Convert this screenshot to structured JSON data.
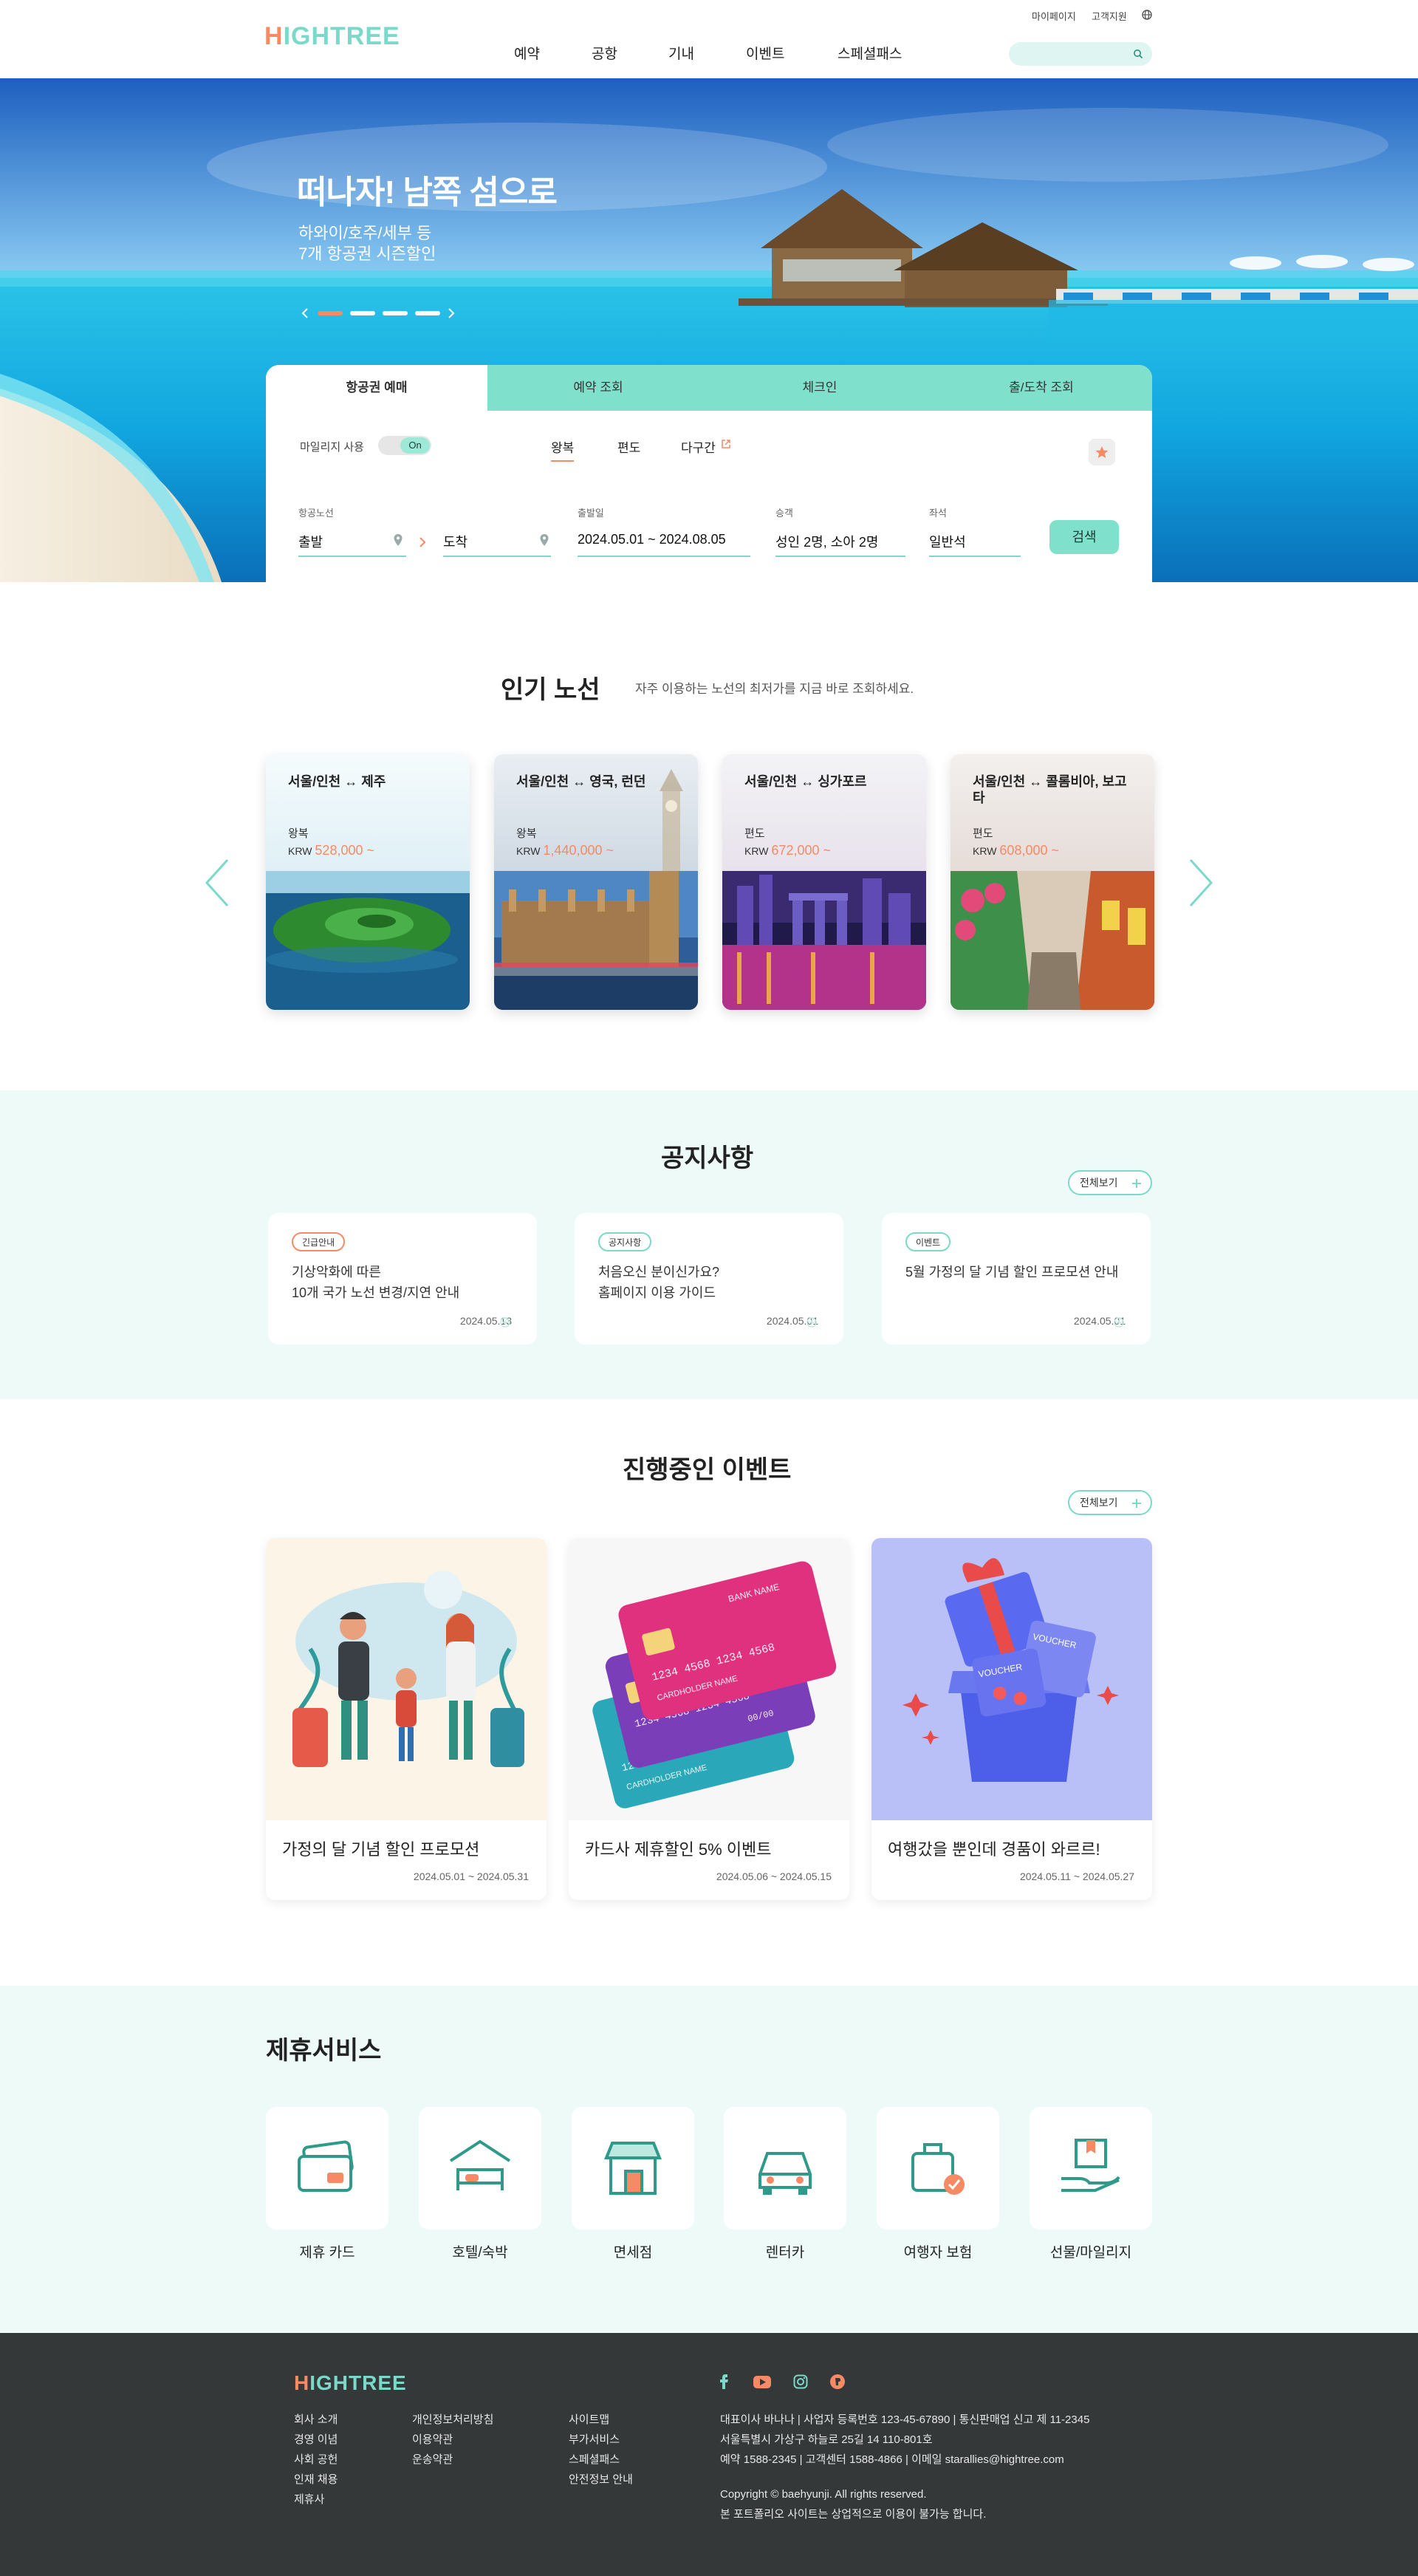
{
  "header": {
    "logo_first": "H",
    "logo_rest": "IGHTREE",
    "util_mypage": "마이페이지",
    "util_support": "고객지원",
    "nav": [
      "예약",
      "공항",
      "기내",
      "이벤트",
      "스페셜패스"
    ],
    "search_icon": "search-icon"
  },
  "hero": {
    "title": "떠나자! 남쪽 섬으로",
    "sub1": "하와이/호주/세부 등",
    "sub2": "7개 항공권 시즌할인"
  },
  "booking": {
    "tabs": [
      "항공권 예매",
      "예약 조회",
      "체크인",
      "출/도착 조회"
    ],
    "mileage_label": "마일리지 사용",
    "mileage_toggle": "On",
    "trip_types": [
      "왕복",
      "편도",
      "다구간"
    ],
    "route_label": "항공노선",
    "from": "출발",
    "to": "도착",
    "date_label": "출발일",
    "date_value": "2024.05.01 ~ 2024.08.05",
    "pax_label": "승객",
    "pax_value": "성인 2명, 소아 2명",
    "seat_label": "좌석",
    "seat_value": "일반석",
    "search_button": "검색"
  },
  "popular": {
    "title": "인기 노선",
    "subtitle": "자주 이용하는 노선의 최저가를 지금 바로 조회하세요.",
    "routes": [
      {
        "name": "서울/인천 ↔ 제주",
        "trip": "왕복",
        "currency": "KRW",
        "price": "528,000 ~"
      },
      {
        "name": "서울/인천 ↔ 영국, 런던",
        "trip": "왕복",
        "currency": "KRW",
        "price": "1,440,000 ~"
      },
      {
        "name": "서울/인천 ↔ 싱가포르",
        "trip": "편도",
        "currency": "KRW",
        "price": "672,000 ~"
      },
      {
        "name": "서울/인천 ↔ 콜롬비아, 보고타",
        "trip": "편도",
        "currency": "KRW",
        "price": "608,000 ~"
      }
    ]
  },
  "notice": {
    "title": "공지사항",
    "more": "전체보기",
    "items": [
      {
        "badge": "긴급안내",
        "line1": "기상악화에 따른",
        "line2": "10개 국가 노선 변경/지연 안내",
        "date": "2024.05.13"
      },
      {
        "badge": "공지사항",
        "line1": "처음오신 분이신가요?",
        "line2": "홈페이지 이용 가이드",
        "date": "2024.05.01"
      },
      {
        "badge": "이벤트",
        "line1": "5월 가정의 달 기념 할인 프로모션 안내",
        "line2": "",
        "date": "2024.05.01"
      }
    ]
  },
  "events": {
    "title": "진행중인 이벤트",
    "more": "전체보기",
    "items": [
      {
        "title": "가정의 달 기념 할인 프로모션",
        "date": "2024.05.01 ~ 2024.05.31"
      },
      {
        "title": "카드사 제휴할인 5% 이벤트",
        "date": "2024.05.06 ~ 2024.05.15"
      },
      {
        "title": "여행갔을 뿐인데 경품이 와르르!",
        "date": "2024.05.11 ~ 2024.05.27"
      }
    ],
    "card_text": [
      "BANK NAME",
      "1234 4568 1234 4568",
      "00/00",
      "CARDHOLDER NAME"
    ],
    "voucher_text": "VOUCHER"
  },
  "partners": {
    "title": "제휴서비스",
    "items": [
      "제휴 카드",
      "호텔/숙박",
      "면세점",
      "렌터카",
      "여행자 보험",
      "선물/마일리지"
    ]
  },
  "footer": {
    "logo_first": "H",
    "logo_rest": "IGHTREE",
    "col1": [
      "회사 소개",
      "경영 이념",
      "사회 공헌",
      "인재 채용",
      "제휴사"
    ],
    "col2": [
      "개인정보처리방침",
      "이용약관",
      "운송약관"
    ],
    "col3": [
      "사이트맵",
      "부가서비스",
      "스페셜패스",
      "안전정보 안내"
    ],
    "info1": "대표이사 바나나 | 사업자 등록번호 123-45-67890 | 통신판매업 신고 제 11-2345",
    "info2": "서울특별시 가상구 하늘로 25길 14 110-801호",
    "info3": "예약 1588-2345 | 고객센터 1588-4866 | 이메일 starallies@hightree.com",
    "copyright": "Copyright © baehyunji. All rights reserved.",
    "notice": "본 포트폴리오 사이트는 상업적으로 이용이 불가능 합니다."
  },
  "colors": {
    "mint": "#7ad9c9",
    "orange": "#f68a65",
    "dark": "#343838",
    "mint_bg": "#eefaf8"
  }
}
